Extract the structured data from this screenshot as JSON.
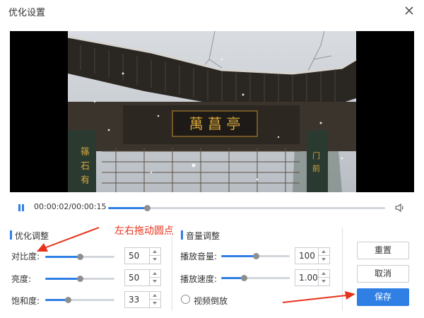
{
  "dialog": {
    "title": "优化设置"
  },
  "player": {
    "timecode": "00:00:02/00:00:15",
    "progress": 0.14
  },
  "annotation": {
    "text": "左右拖动圆点"
  },
  "optimize": {
    "title": "优化调整",
    "rows": [
      {
        "label": "对比度:",
        "value": "50",
        "level": 0.5
      },
      {
        "label": "亮度:",
        "value": "50",
        "level": 0.5
      },
      {
        "label": "饱和度:",
        "value": "33",
        "level": 0.33
      }
    ]
  },
  "audio": {
    "title": "音量调整",
    "volume": {
      "label": "播放音量:",
      "value": "100",
      "level": 0.5
    },
    "speed": {
      "label": "播放速度:",
      "value": "1.00",
      "level": 0.33
    },
    "reverse_label": "视频倒放"
  },
  "buttons": {
    "reset": "重置",
    "cancel": "取消",
    "save": "保存"
  },
  "colors": {
    "accent": "#2f7fe5",
    "annotation": "#e8331c"
  },
  "icons": {
    "close": "close-icon",
    "pause": "pause-icon",
    "volume": "volume-icon"
  }
}
